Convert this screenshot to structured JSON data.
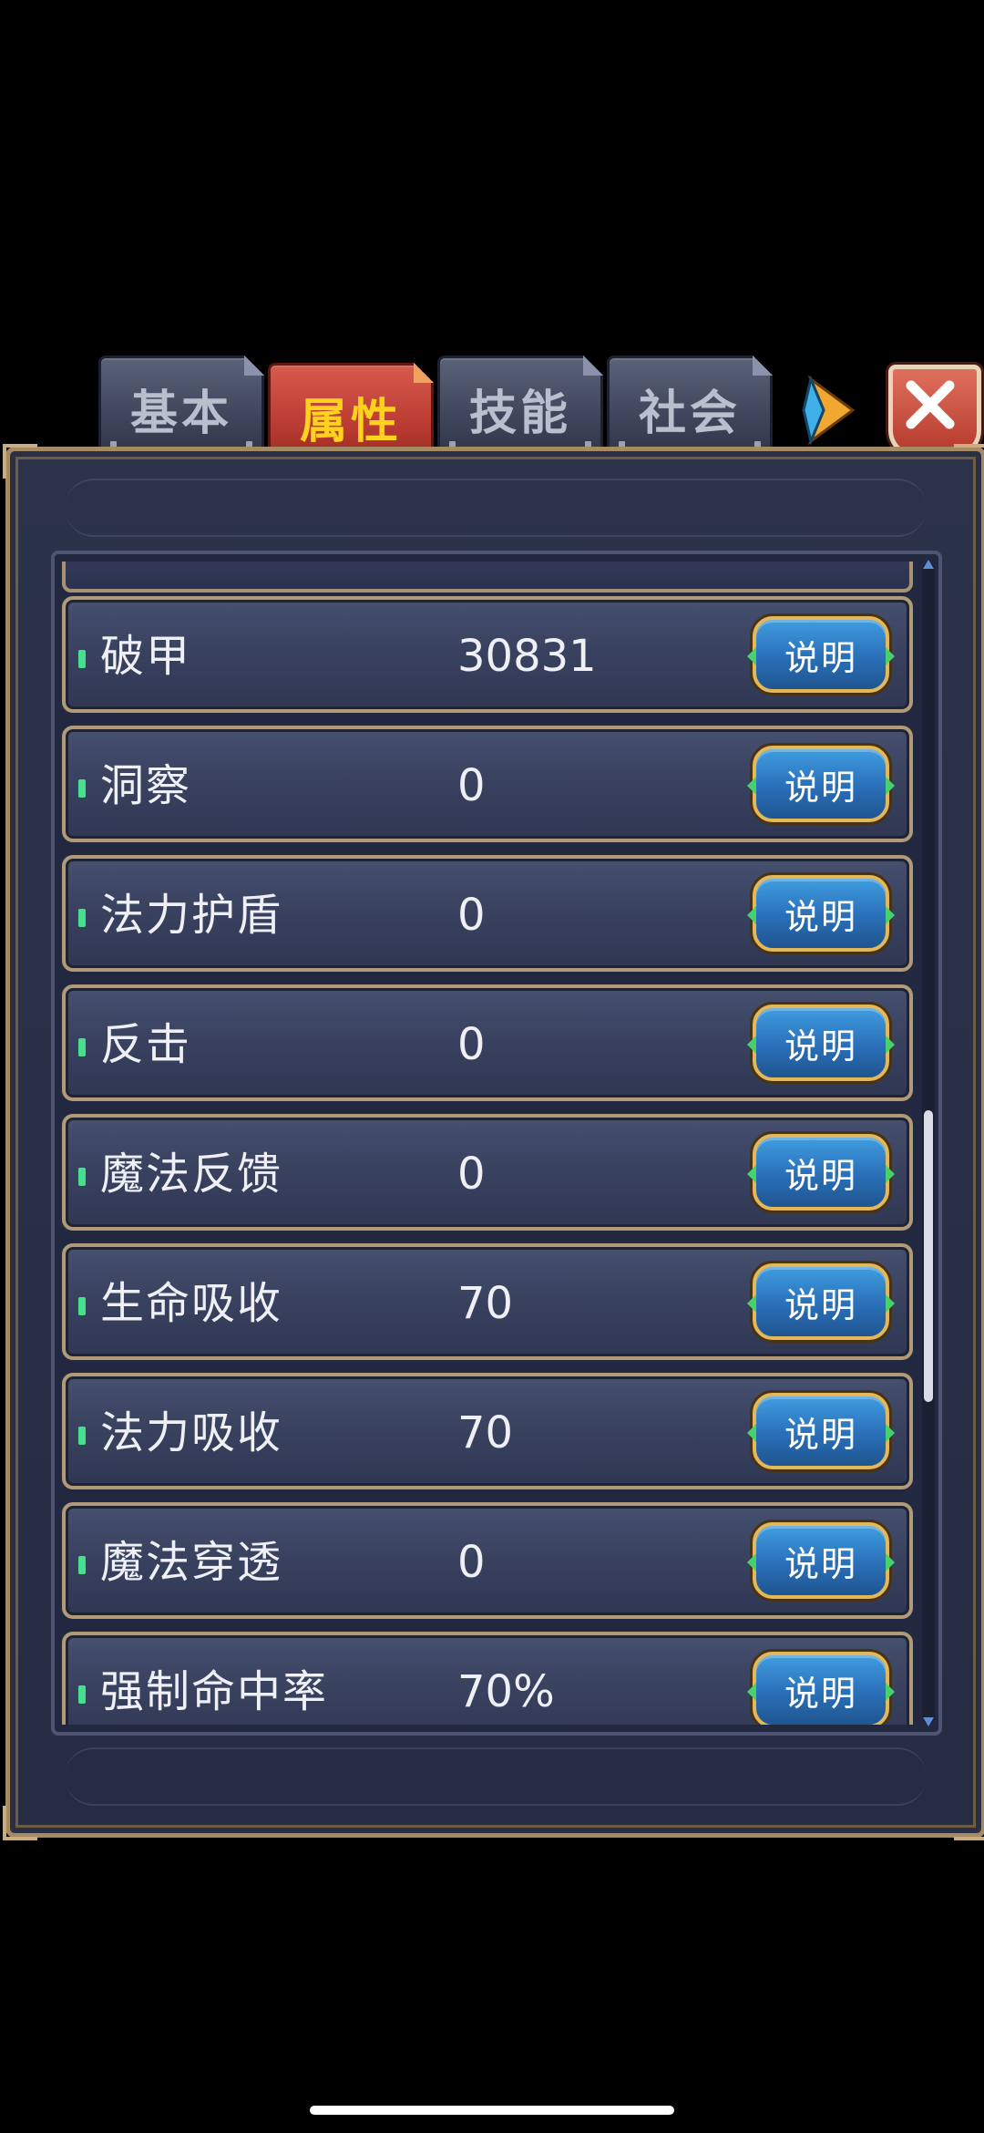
{
  "tabs": [
    {
      "label": "基本",
      "active": false
    },
    {
      "label": "属性",
      "active": true
    },
    {
      "label": "技能",
      "active": false
    },
    {
      "label": "社会",
      "active": false
    }
  ],
  "icons": {
    "next": "arrow-right-icon",
    "close": "close-icon"
  },
  "attributes": [
    {
      "label": "破甲",
      "value": "30831",
      "button": "说明"
    },
    {
      "label": "洞察",
      "value": "0",
      "button": "说明"
    },
    {
      "label": "法力护盾",
      "value": "0",
      "button": "说明"
    },
    {
      "label": "反击",
      "value": "0",
      "button": "说明"
    },
    {
      "label": "魔法反馈",
      "value": "0",
      "button": "说明"
    },
    {
      "label": "生命吸收",
      "value": "70",
      "button": "说明"
    },
    {
      "label": "法力吸收",
      "value": "70",
      "button": "说明"
    },
    {
      "label": "魔法穿透",
      "value": "0",
      "button": "说明"
    },
    {
      "label": "强制命中率",
      "value": "70%",
      "button": "说明"
    }
  ],
  "colors": {
    "active_tab_text": "#ffd21e",
    "row_marker": "#47e08e",
    "button_blue": "#2a6fb8",
    "frame_gold": "#b09a78"
  }
}
